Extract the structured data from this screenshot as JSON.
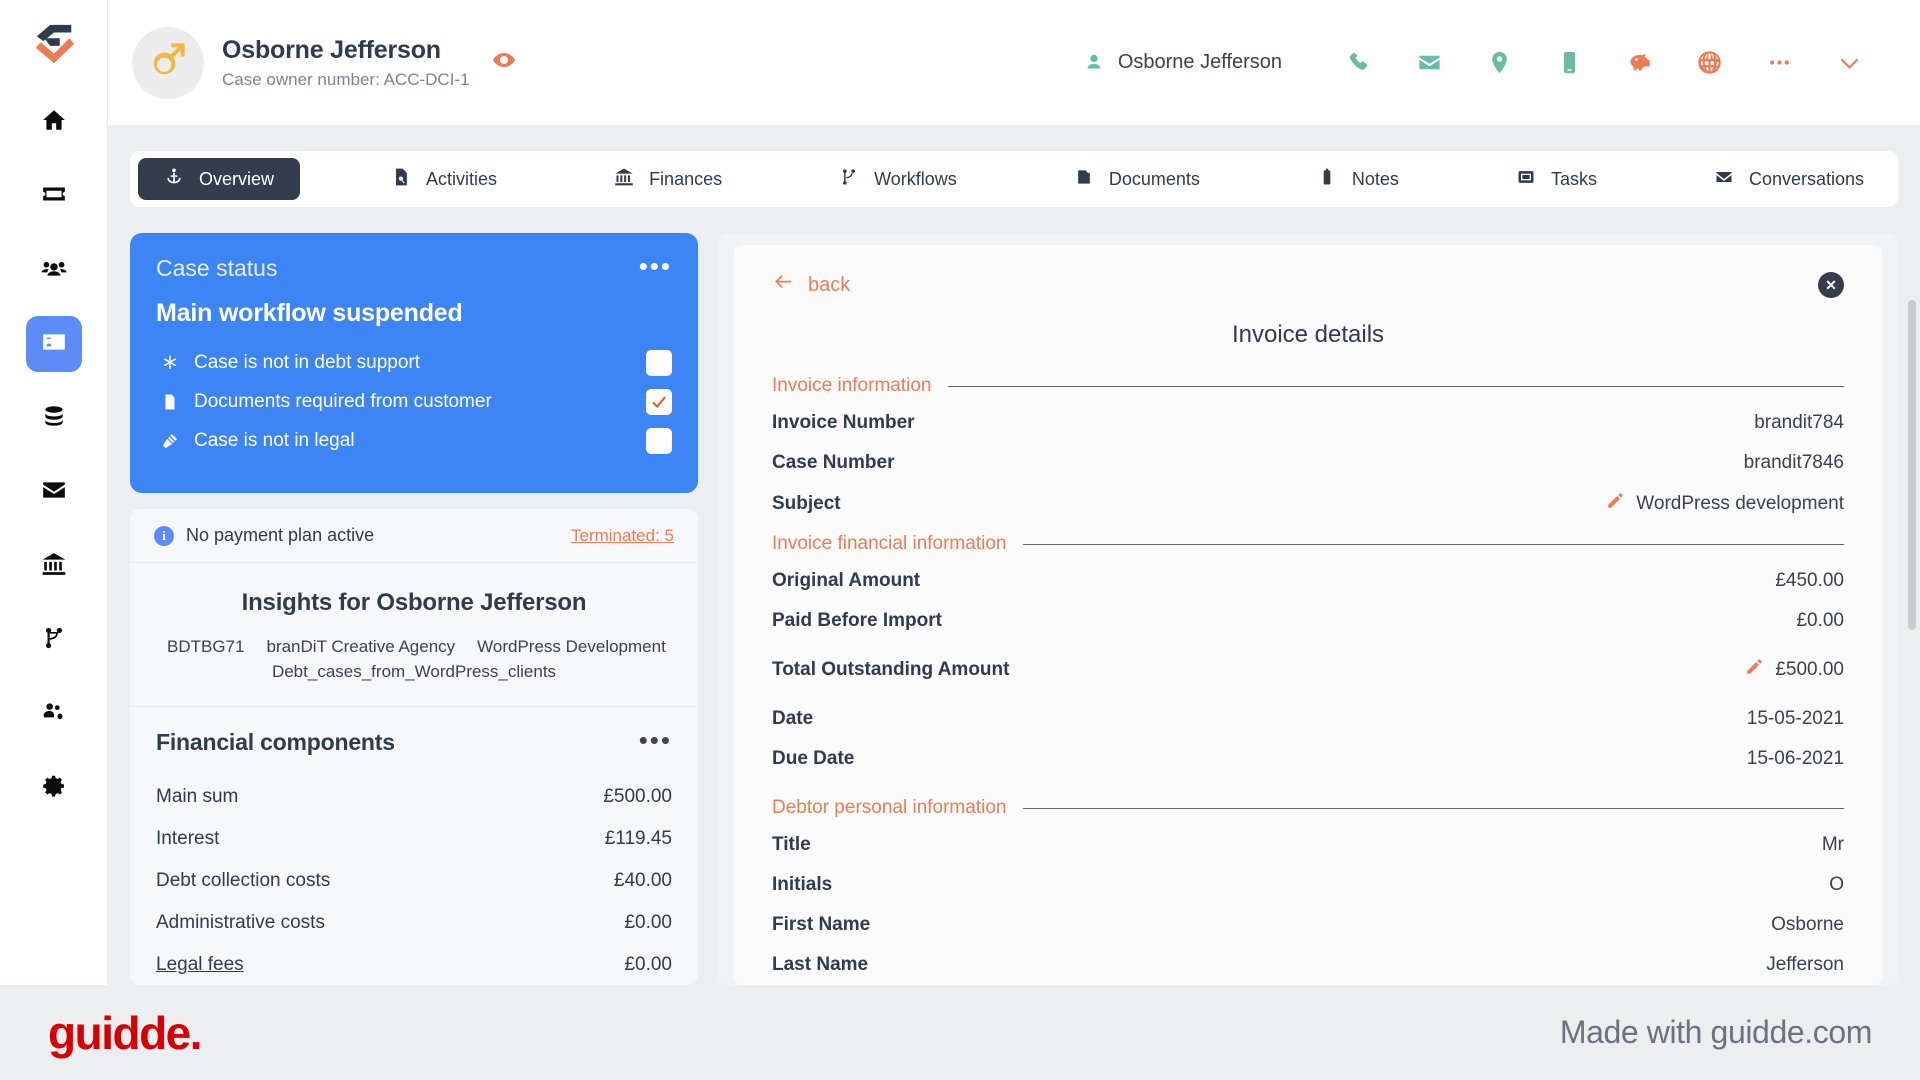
{
  "sidebar": {
    "logo_name": "app-logo",
    "items": [
      {
        "name": "home",
        "icon": "home-icon",
        "active": false
      },
      {
        "name": "cases-board",
        "icon": "card-icon",
        "active": false
      },
      {
        "name": "customers",
        "icon": "people-icon",
        "active": false
      },
      {
        "name": "debtor-profile",
        "icon": "id-card-icon",
        "active": true
      },
      {
        "name": "data",
        "icon": "database-icon",
        "active": false
      },
      {
        "name": "mail",
        "icon": "envelope-icon",
        "active": false
      },
      {
        "name": "bank",
        "icon": "bank-icon",
        "active": false
      },
      {
        "name": "workflows",
        "icon": "branch-icon",
        "active": false
      },
      {
        "name": "team-settings",
        "icon": "people-gear-icon",
        "active": false
      },
      {
        "name": "settings",
        "icon": "gear-icon",
        "active": false
      }
    ]
  },
  "header": {
    "avatar_icon": "male-gender-icon",
    "name": "Osborne Jefferson",
    "case_owner_number": "Case owner number: ACC-DCI-1",
    "visibility_icon": "eye-icon",
    "account_user": "Osborne Jefferson",
    "account_user_icon": "person-icon",
    "icons": [
      {
        "name": "phone-icon",
        "color": "#68bba6"
      },
      {
        "name": "envelope-icon",
        "color": "#68bba6"
      },
      {
        "name": "location-pin-icon",
        "color": "#68bba6"
      },
      {
        "name": "mobile-icon",
        "color": "#68bba6"
      },
      {
        "name": "piggy-bank-icon",
        "color": "#ef7b53"
      },
      {
        "name": "globe-icon",
        "color": "#ef7b53"
      },
      {
        "name": "ellipsis-icon",
        "color": "#ef7b53"
      },
      {
        "name": "chevron-down-icon",
        "color": "#ef7b53"
      }
    ]
  },
  "tabs": [
    {
      "label": "Overview",
      "icon": "anchor-icon",
      "active": true
    },
    {
      "label": "Activities",
      "icon": "file-search-icon",
      "active": false
    },
    {
      "label": "Finances",
      "icon": "bank-icon",
      "active": false
    },
    {
      "label": "Workflows",
      "icon": "branch-icon",
      "active": false
    },
    {
      "label": "Documents",
      "icon": "folder-icon",
      "active": false
    },
    {
      "label": "Notes",
      "icon": "note-icon",
      "active": false
    },
    {
      "label": "Tasks",
      "icon": "task-icon",
      "active": false
    },
    {
      "label": "Conversations",
      "icon": "envelope-icon",
      "active": false
    }
  ],
  "case_status": {
    "title": "Case status",
    "menu_icon": "ellipsis-icon",
    "headline": "Main workflow suspended",
    "items": [
      {
        "label": "Case is not in debt support",
        "icon": "asterisk-icon",
        "checked": false
      },
      {
        "label": "Documents required from customer",
        "icon": "document-icon",
        "checked": true
      },
      {
        "label": "Case is not in legal",
        "icon": "gavel-icon",
        "checked": false
      }
    ]
  },
  "payment_plan": {
    "info_icon": "info-icon",
    "text": "No payment plan active",
    "link": "Terminated: 5"
  },
  "insights": {
    "title": "Insights for Osborne Jefferson",
    "chips": [
      "BDTBG71",
      "branDiT Creative Agency",
      "WordPress Development",
      "Debt_cases_from_WordPress_clients"
    ]
  },
  "financial_components": {
    "title": "Financial components",
    "menu_icon": "ellipsis-icon",
    "rows": [
      {
        "key": "Main sum",
        "value": "£500.00",
        "link": false
      },
      {
        "key": "Interest",
        "value": "£119.45",
        "link": false
      },
      {
        "key": "Debt collection costs",
        "value": "£40.00",
        "link": false
      },
      {
        "key": "Administrative costs",
        "value": "£0.00",
        "link": false
      },
      {
        "key": "Legal fees",
        "value": "£0.00",
        "link": true
      }
    ]
  },
  "invoice_details": {
    "back_label": "back",
    "back_icon": "arrow-left-icon",
    "close_icon": "close-icon",
    "close_label": "✕",
    "title": "Invoice details",
    "sections": [
      {
        "label": "Invoice information",
        "rows": [
          {
            "key": "Invoice Number",
            "value": "brandit784",
            "editable": false
          },
          {
            "key": "Case Number",
            "value": "brandit7846",
            "editable": false
          },
          {
            "key": "Subject",
            "value": "WordPress development",
            "editable": true
          }
        ]
      },
      {
        "label": "Invoice financial information",
        "rows": [
          {
            "key": "Original Amount",
            "value": "£450.00",
            "editable": false
          },
          {
            "key": "Paid Before Import",
            "value": "£0.00",
            "editable": false
          },
          {
            "key": "Total Outstanding Amount",
            "value": "£500.00",
            "editable": true,
            "gap_before": true
          },
          {
            "key": "Date",
            "value": "15-05-2021",
            "editable": false,
            "gap_before": true
          },
          {
            "key": "Due Date",
            "value": "15-06-2021",
            "editable": false
          }
        ]
      },
      {
        "label": "Debtor personal information",
        "rows": [
          {
            "key": "Title",
            "value": "Mr",
            "editable": false
          },
          {
            "key": "Initials",
            "value": "O",
            "editable": false
          },
          {
            "key": "First Name",
            "value": "Osborne",
            "editable": false
          },
          {
            "key": "Last Name",
            "value": "Jefferson",
            "editable": false
          }
        ]
      }
    ]
  },
  "brand": {
    "logo": "guidde.",
    "made_with": "Made with guidde.com",
    "logo_color": "#d70000"
  }
}
